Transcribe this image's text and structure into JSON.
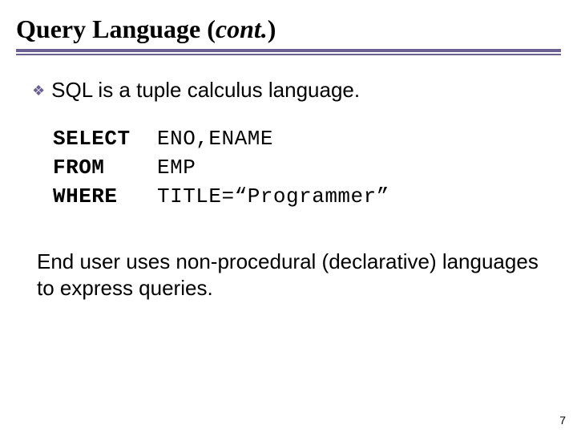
{
  "title_prefix": "Query Language (",
  "title_cont": "cont.",
  "title_suffix": ")",
  "bullet": {
    "mark": "❖",
    "text": "SQL is a tuple calculus language."
  },
  "sql": {
    "rows": [
      {
        "kw": "SELECT",
        "val": "ENO,ENAME"
      },
      {
        "kw": "FROM",
        "val": "EMP"
      },
      {
        "kw": "WHERE",
        "val": "TITLE=“Programmer”"
      }
    ]
  },
  "end_note": "End user uses non-procedural (declarative) languages to express queries.",
  "page_number": "7"
}
